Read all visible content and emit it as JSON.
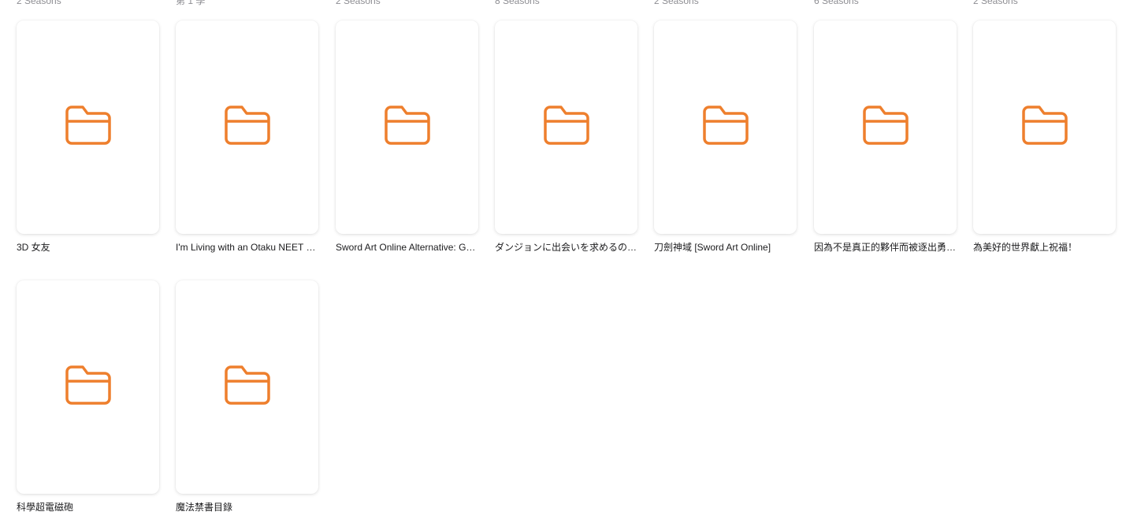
{
  "accent": "#ee7f2d",
  "top_subtitles": [
    "2 Seasons",
    "第 1 季",
    "2 Seasons",
    "8 Seasons",
    "2 Seasons",
    "6 Seasons",
    "2 Seasons"
  ],
  "items": [
    {
      "title": "3D 女友",
      "icon": "folder-icon"
    },
    {
      "title": "I'm Living with an Otaku NEET Kunoichi!? There's a Whole Lot of Ninja",
      "icon": "folder-icon"
    },
    {
      "title": "Sword Art Online Alternative: Gun Gale Online",
      "icon": "folder-icon"
    },
    {
      "title": "ダンジョンに出会いを求めるのは間違っているだろうか",
      "icon": "folder-icon"
    },
    {
      "title": "刀劍神域 [Sword Art Online]",
      "icon": "folder-icon"
    },
    {
      "title": "因為不是真正的夥伴而被逐出勇者隊伍",
      "icon": "folder-icon"
    },
    {
      "title": "為美好的世界獻上祝福！",
      "icon": "folder-icon"
    },
    {
      "title": "科學超電磁砲",
      "icon": "folder-icon"
    },
    {
      "title": "魔法禁書目錄",
      "icon": "folder-icon"
    }
  ]
}
